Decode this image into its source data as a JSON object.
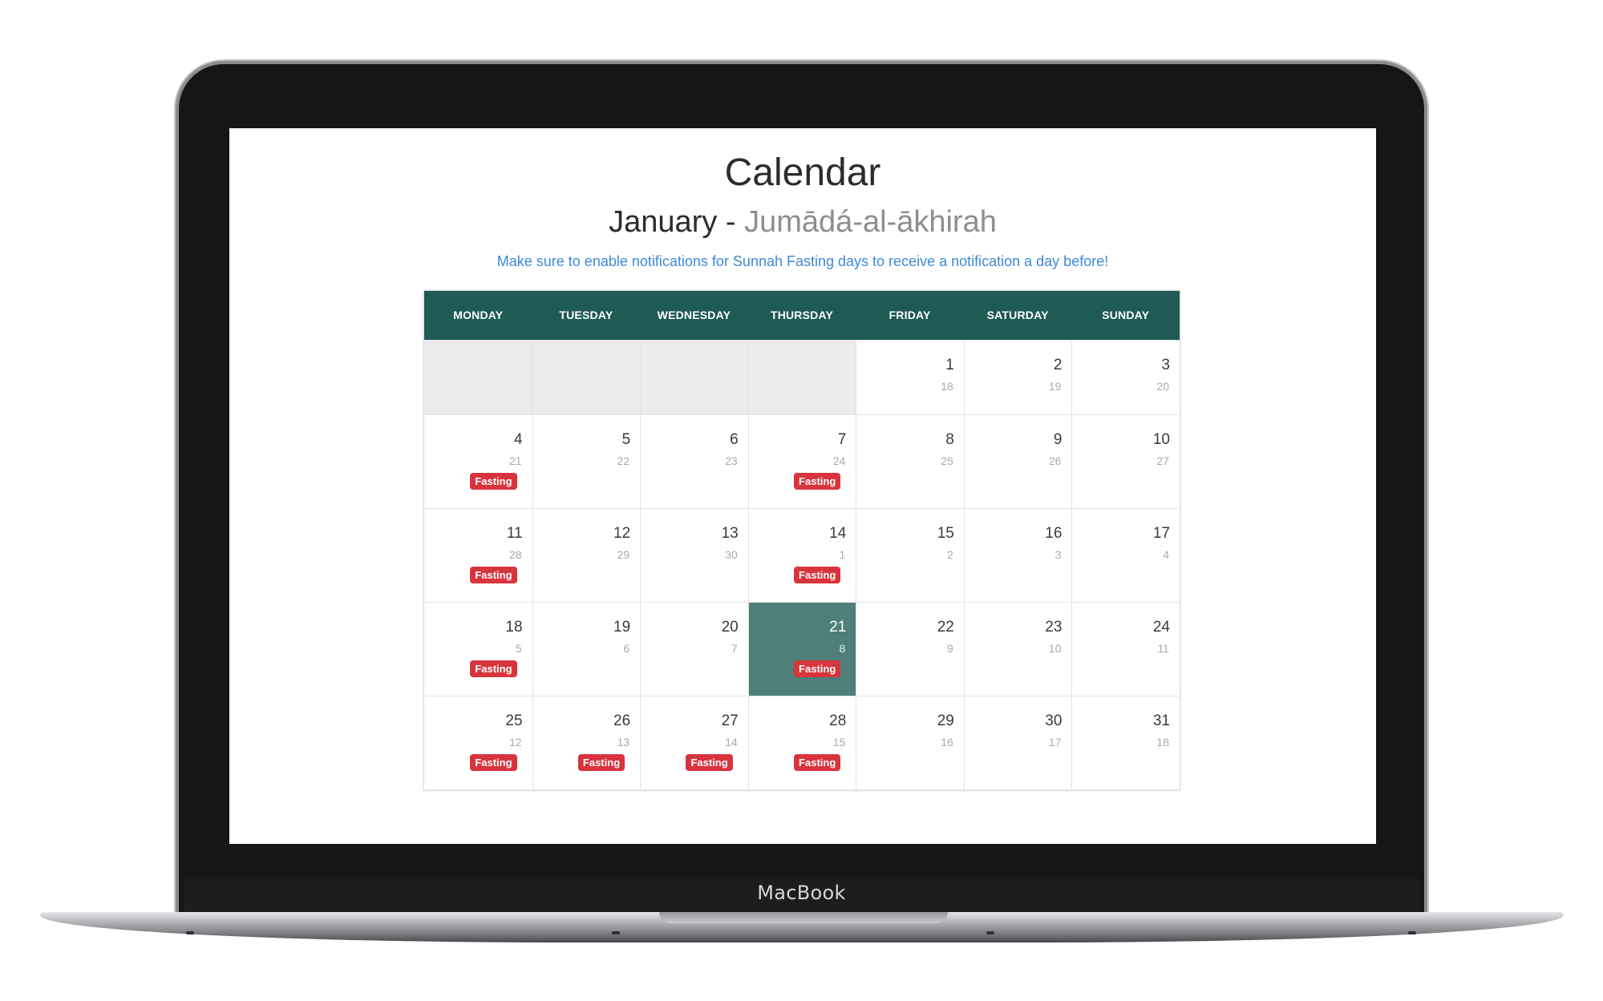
{
  "device": {
    "brand": "MacBook"
  },
  "page": {
    "title": "Calendar",
    "subtitle_gregorian": "January - ",
    "subtitle_hijri": "Jumādá-al-ākhirah",
    "notice": "Make sure to enable notifications for Sunnah Fasting days to receive a notification a day before!"
  },
  "colors": {
    "header_bg": "#1f5a54",
    "today_bg": "#4e7f78",
    "badge_bg": "#d8343d",
    "notice": "#3d8ad8",
    "empty_cell": "#ebebeb"
  },
  "calendar": {
    "weekdays": [
      "MONDAY",
      "TUESDAY",
      "WEDNESDAY",
      "THURSDAY",
      "FRIDAY",
      "SATURDAY",
      "SUNDAY"
    ],
    "badge_label": "Fasting",
    "weeks": [
      [
        null,
        null,
        null,
        null,
        {
          "day": "1",
          "hijri": "18",
          "fasting": false,
          "today": false
        },
        {
          "day": "2",
          "hijri": "19",
          "fasting": false,
          "today": false
        },
        {
          "day": "3",
          "hijri": "20",
          "fasting": false,
          "today": false
        }
      ],
      [
        {
          "day": "4",
          "hijri": "21",
          "fasting": true,
          "today": false
        },
        {
          "day": "5",
          "hijri": "22",
          "fasting": false,
          "today": false
        },
        {
          "day": "6",
          "hijri": "23",
          "fasting": false,
          "today": false
        },
        {
          "day": "7",
          "hijri": "24",
          "fasting": true,
          "today": false
        },
        {
          "day": "8",
          "hijri": "25",
          "fasting": false,
          "today": false
        },
        {
          "day": "9",
          "hijri": "26",
          "fasting": false,
          "today": false
        },
        {
          "day": "10",
          "hijri": "27",
          "fasting": false,
          "today": false
        }
      ],
      [
        {
          "day": "11",
          "hijri": "28",
          "fasting": true,
          "today": false
        },
        {
          "day": "12",
          "hijri": "29",
          "fasting": false,
          "today": false
        },
        {
          "day": "13",
          "hijri": "30",
          "fasting": false,
          "today": false
        },
        {
          "day": "14",
          "hijri": "1",
          "fasting": true,
          "today": false
        },
        {
          "day": "15",
          "hijri": "2",
          "fasting": false,
          "today": false
        },
        {
          "day": "16",
          "hijri": "3",
          "fasting": false,
          "today": false
        },
        {
          "day": "17",
          "hijri": "4",
          "fasting": false,
          "today": false
        }
      ],
      [
        {
          "day": "18",
          "hijri": "5",
          "fasting": true,
          "today": false
        },
        {
          "day": "19",
          "hijri": "6",
          "fasting": false,
          "today": false
        },
        {
          "day": "20",
          "hijri": "7",
          "fasting": false,
          "today": false
        },
        {
          "day": "21",
          "hijri": "8",
          "fasting": true,
          "today": true
        },
        {
          "day": "22",
          "hijri": "9",
          "fasting": false,
          "today": false
        },
        {
          "day": "23",
          "hijri": "10",
          "fasting": false,
          "today": false
        },
        {
          "day": "24",
          "hijri": "11",
          "fasting": false,
          "today": false
        }
      ],
      [
        {
          "day": "25",
          "hijri": "12",
          "fasting": true,
          "today": false
        },
        {
          "day": "26",
          "hijri": "13",
          "fasting": true,
          "today": false
        },
        {
          "day": "27",
          "hijri": "14",
          "fasting": true,
          "today": false
        },
        {
          "day": "28",
          "hijri": "15",
          "fasting": true,
          "today": false
        },
        {
          "day": "29",
          "hijri": "16",
          "fasting": false,
          "today": false
        },
        {
          "day": "30",
          "hijri": "17",
          "fasting": false,
          "today": false
        },
        {
          "day": "31",
          "hijri": "18",
          "fasting": false,
          "today": false
        }
      ]
    ]
  }
}
